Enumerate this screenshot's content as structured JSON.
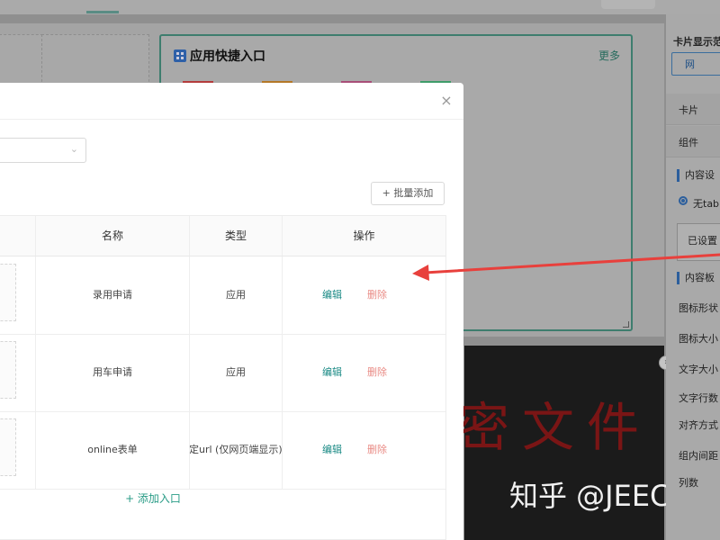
{
  "card": {
    "title": "应用快捷入口",
    "more": "更多",
    "tile_colors": [
      "#b43c3c",
      "#b47828",
      "#a84f78",
      "#3f9c6a"
    ]
  },
  "right_panel": {
    "title": "卡片显示范",
    "btn": "网",
    "row1": "卡片",
    "row2": "组件",
    "sec1": "内容设",
    "radio": "无tab",
    "box": "已设置",
    "sec2": "内容板",
    "labels": [
      "图标形状",
      "图标大小",
      "文字大小",
      "文字行数",
      "对齐方式",
      "组内间距",
      "列数"
    ]
  },
  "watermark": {
    "big": "密文件",
    "zhihu": "知乎 @JEECG低"
  },
  "modal": {
    "close": "×",
    "batch_add": "+ 批量添加",
    "columns": {
      "name": "名称",
      "type": "类型",
      "action": "操作"
    },
    "rows": [
      {
        "name": "录用申请",
        "type": "应用",
        "edit": "编辑",
        "delete": "删除"
      },
      {
        "name": "用车申请",
        "type": "应用",
        "edit": "编辑",
        "delete": "删除"
      },
      {
        "name": "online表单",
        "type": "指定url (仅网页端显示)",
        "edit": "编辑",
        "delete": "删除"
      }
    ],
    "add_entry": "+ 添加入口"
  },
  "colors": {
    "accent": "#1a8a85",
    "danger": "#e98b85",
    "arrow": "#e8403c",
    "primary_blue": "#2c5f9d"
  }
}
